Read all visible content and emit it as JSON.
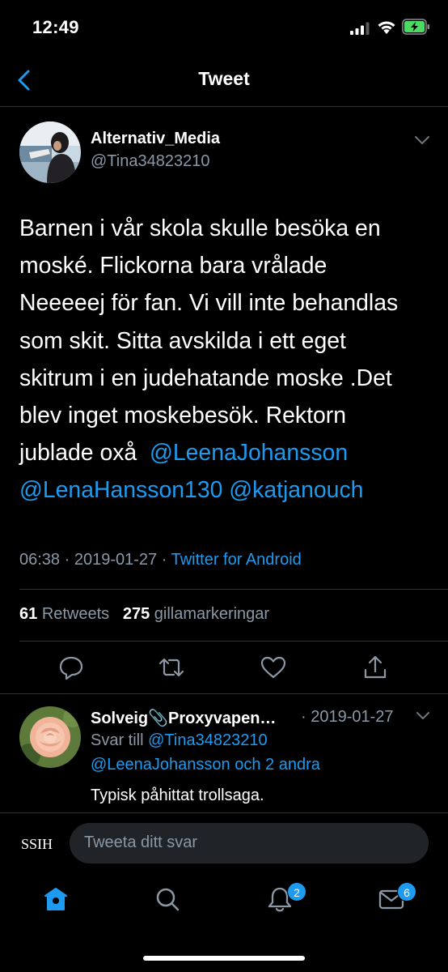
{
  "status": {
    "time": "12:49"
  },
  "nav": {
    "title": "Tweet"
  },
  "tweet": {
    "author_name": "Alternativ_Media",
    "author_handle": "@Tina34823210",
    "lines": [
      "Barnen i vår skola skulle besöka en",
      "moské. Flickorna bara vrålade",
      "Neeeeej för fan. Vi vill inte behandlas",
      "som skit. Sitta avskilda i ett eget",
      "skitrum i en judehatande moske .Det",
      "blev inget moskebesök. Rektorn"
    ],
    "last_line_prefix": "jublade oxå ",
    "mentions": [
      "@LeenaJohansson",
      "@LenaHansson130",
      "@katjanouch"
    ],
    "time": "06:38",
    "date": "2019-01-27",
    "separator": " · ",
    "source": "Twitter for Android",
    "retweet_count": "61",
    "retweet_label": "Retweets",
    "like_count": "275",
    "like_label": "gillamarkeringar"
  },
  "reply": {
    "author_name": "Solveig📎Proxyvapen…",
    "date": "· 2019-01-27",
    "reply_to_prefix": "Svar till ",
    "reply_to_handle": "@Tina34823210",
    "reply_to_more": "@LeenaJohansson och 2 andra",
    "text": "Typisk påhittat trollsaga."
  },
  "composer": {
    "logo": "SSIH",
    "placeholder": "Tweeta ditt svar"
  },
  "tabs": {
    "notifications_badge": "2",
    "messages_badge": "6"
  },
  "colors": {
    "accent": "#1d9bf0",
    "secondary_text": "#8b98a5",
    "background": "#000000",
    "battery": "#4cd964"
  },
  "icons": {
    "back": "chevron-left-icon",
    "caret": "chevron-down-icon",
    "reply": "reply-icon",
    "retweet": "retweet-icon",
    "like": "heart-icon",
    "share": "share-icon",
    "home": "home-icon",
    "search": "search-icon",
    "notifications": "bell-icon",
    "messages": "mail-icon"
  }
}
